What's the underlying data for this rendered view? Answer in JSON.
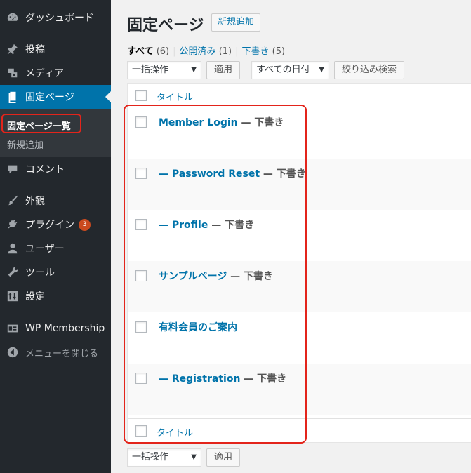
{
  "sidebar": {
    "dashboard": "ダッシュボード",
    "posts": "投稿",
    "media": "メディア",
    "pages": "固定ページ",
    "submenu": {
      "all_pages": "固定ページ一覧",
      "add_new": "新規追加"
    },
    "comments": "コメント",
    "appearance": "外観",
    "plugins": "プラグイン",
    "plugins_badge": "3",
    "users": "ユーザー",
    "tools": "ツール",
    "settings": "設定",
    "wp_membership": "WP Membership",
    "collapse": "メニューを閉じる"
  },
  "header": {
    "title": "固定ページ",
    "add_new": "新規追加"
  },
  "filters": {
    "all": "すべて",
    "all_count": "(6)",
    "published": "公開済み",
    "published_count": "(1)",
    "drafts": "下書き",
    "drafts_count": "(5)"
  },
  "toolbar": {
    "bulk_action": "一括操作",
    "apply": "適用",
    "date_filter": "すべての日付",
    "filter_button": "絞り込み検索"
  },
  "table": {
    "column_title": "タイトル",
    "rows": [
      {
        "title": "Member Login",
        "state": " — 下書き"
      },
      {
        "title": "— Password Reset",
        "state": " — 下書き"
      },
      {
        "title": "— Profile",
        "state": " — 下書き"
      },
      {
        "title": "サンプルページ",
        "state": " — 下書き"
      },
      {
        "title": "有料会員のご案内",
        "state": ""
      },
      {
        "title": "— Registration",
        "state": " — 下書き"
      }
    ]
  },
  "bottom_toolbar": {
    "bulk_action": "一括操作",
    "apply": "適用"
  },
  "colors": {
    "sidebar_bg": "#23282d",
    "active_bg": "#0073aa",
    "link": "#0073aa",
    "highlight": "#e3241b",
    "badge": "#ca4a1f"
  }
}
